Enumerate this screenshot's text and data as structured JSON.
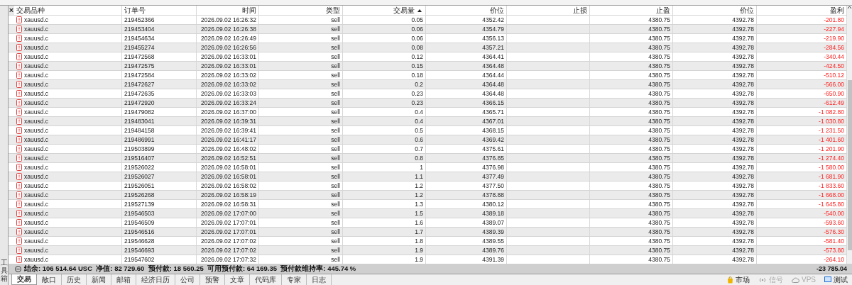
{
  "toolbox_label": "工具箱",
  "columns": [
    {
      "label": "交易品种",
      "sorted": false
    },
    {
      "label": "订单号",
      "sorted": false
    },
    {
      "label": "时间",
      "sorted": false
    },
    {
      "label": "类型",
      "sorted": false
    },
    {
      "label": "交易量",
      "sorted": true
    },
    {
      "label": "价位",
      "sorted": false
    },
    {
      "label": "止损",
      "sorted": false
    },
    {
      "label": "止盈",
      "sorted": false
    },
    {
      "label": "价位",
      "sorted": false
    },
    {
      "label": "盈利",
      "sorted": false
    }
  ],
  "close_glyph": "×",
  "rows": [
    {
      "symbol": "xauusd.c",
      "order": "219452366",
      "time": "2026.09.02 16:26:32",
      "type": "sell",
      "volume": "0.05",
      "price": "4352.42",
      "tp": "4380.75",
      "current": "4392.78",
      "profit": "-201.80"
    },
    {
      "symbol": "xauusd.c",
      "order": "219453404",
      "time": "2026.09.02 16:26:38",
      "type": "sell",
      "volume": "0.06",
      "price": "4354.79",
      "tp": "4380.75",
      "current": "4392.78",
      "profit": "-227.94"
    },
    {
      "symbol": "xauusd.c",
      "order": "219454634",
      "time": "2026.09.02 16:26:49",
      "type": "sell",
      "volume": "0.06",
      "price": "4356.13",
      "tp": "4380.75",
      "current": "4392.78",
      "profit": "-219.90"
    },
    {
      "symbol": "xauusd.c",
      "order": "219455274",
      "time": "2026.09.02 16:26:56",
      "type": "sell",
      "volume": "0.08",
      "price": "4357.21",
      "tp": "4380.75",
      "current": "4392.78",
      "profit": "-284.56"
    },
    {
      "symbol": "xauusd.c",
      "order": "219472568",
      "time": "2026.09.02 16:33:01",
      "type": "sell",
      "volume": "0.12",
      "price": "4364.41",
      "tp": "4380.75",
      "current": "4392.78",
      "profit": "-340.44"
    },
    {
      "symbol": "xauusd.c",
      "order": "219472575",
      "time": "2026.09.02 16:33:01",
      "type": "sell",
      "volume": "0.15",
      "price": "4364.48",
      "tp": "4380.75",
      "current": "4392.78",
      "profit": "-424.50"
    },
    {
      "symbol": "xauusd.c",
      "order": "219472584",
      "time": "2026.09.02 16:33:02",
      "type": "sell",
      "volume": "0.18",
      "price": "4364.44",
      "tp": "4380.75",
      "current": "4392.78",
      "profit": "-510.12"
    },
    {
      "symbol": "xauusd.c",
      "order": "219472627",
      "time": "2026.09.02 16:33:02",
      "type": "sell",
      "volume": "0.2",
      "price": "4364.48",
      "tp": "4380.75",
      "current": "4392.78",
      "profit": "-566.00"
    },
    {
      "symbol": "xauusd.c",
      "order": "219472635",
      "time": "2026.09.02 16:33:03",
      "type": "sell",
      "volume": "0.23",
      "price": "4364.48",
      "tp": "4380.75",
      "current": "4392.78",
      "profit": "-650.90"
    },
    {
      "symbol": "xauusd.c",
      "order": "219472920",
      "time": "2026.09.02 16:33:24",
      "type": "sell",
      "volume": "0.23",
      "price": "4366.15",
      "tp": "4380.75",
      "current": "4392.78",
      "profit": "-612.49"
    },
    {
      "symbol": "xauusd.c",
      "order": "219479082",
      "time": "2026.09.02 16:37:00",
      "type": "sell",
      "volume": "0.4",
      "price": "4365.71",
      "tp": "4380.75",
      "current": "4392.78",
      "profit": "-1 082.80"
    },
    {
      "symbol": "xauusd.c",
      "order": "219483041",
      "time": "2026.09.02 16:39:31",
      "type": "sell",
      "volume": "0.4",
      "price": "4367.01",
      "tp": "4380.75",
      "current": "4392.78",
      "profit": "-1 030.80"
    },
    {
      "symbol": "xauusd.c",
      "order": "219484158",
      "time": "2026.09.02 16:39:41",
      "type": "sell",
      "volume": "0.5",
      "price": "4368.15",
      "tp": "4380.75",
      "current": "4392.78",
      "profit": "-1 231.50"
    },
    {
      "symbol": "xauusd.c",
      "order": "219486991",
      "time": "2026.09.02 16:41:17",
      "type": "sell",
      "volume": "0.6",
      "price": "4369.42",
      "tp": "4380.75",
      "current": "4392.78",
      "profit": "-1 401.60"
    },
    {
      "symbol": "xauusd.c",
      "order": "219503899",
      "time": "2026.09.02 16:48:02",
      "type": "sell",
      "volume": "0.7",
      "price": "4375.61",
      "tp": "4380.75",
      "current": "4392.78",
      "profit": "-1 201.90"
    },
    {
      "symbol": "xauusd.c",
      "order": "219516407",
      "time": "2026.09.02 16:52:51",
      "type": "sell",
      "volume": "0.8",
      "price": "4376.85",
      "tp": "4380.75",
      "current": "4392.78",
      "profit": "-1 274.40"
    },
    {
      "symbol": "xauusd.c",
      "order": "219526022",
      "time": "2026.09.02 16:58:01",
      "type": "sell",
      "volume": "1",
      "price": "4376.98",
      "tp": "4380.75",
      "current": "4392.78",
      "profit": "-1 580.00"
    },
    {
      "symbol": "xauusd.c",
      "order": "219526027",
      "time": "2026.09.02 16:58:01",
      "type": "sell",
      "volume": "1.1",
      "price": "4377.49",
      "tp": "4380.75",
      "current": "4392.78",
      "profit": "-1 681.90"
    },
    {
      "symbol": "xauusd.c",
      "order": "219526051",
      "time": "2026.09.02 16:58:02",
      "type": "sell",
      "volume": "1.2",
      "price": "4377.50",
      "tp": "4380.75",
      "current": "4392.78",
      "profit": "-1 833.60"
    },
    {
      "symbol": "xauusd.c",
      "order": "219526268",
      "time": "2026.09.02 16:58:19",
      "type": "sell",
      "volume": "1.2",
      "price": "4378.88",
      "tp": "4380.75",
      "current": "4392.78",
      "profit": "-1 668.00"
    },
    {
      "symbol": "xauusd.c",
      "order": "219527139",
      "time": "2026.09.02 16:58:31",
      "type": "sell",
      "volume": "1.3",
      "price": "4380.12",
      "tp": "4380.75",
      "current": "4392.78",
      "profit": "-1 645.80"
    },
    {
      "symbol": "xauusd.c",
      "order": "219546503",
      "time": "2026.09.02 17:07:00",
      "type": "sell",
      "volume": "1.5",
      "price": "4389.18",
      "tp": "4380.75",
      "current": "4392.78",
      "profit": "-540.00"
    },
    {
      "symbol": "xauusd.c",
      "order": "219546509",
      "time": "2026.09.02 17:07:01",
      "type": "sell",
      "volume": "1.6",
      "price": "4389.07",
      "tp": "4380.75",
      "current": "4392.78",
      "profit": "-593.60"
    },
    {
      "symbol": "xauusd.c",
      "order": "219546516",
      "time": "2026.09.02 17:07:01",
      "type": "sell",
      "volume": "1.7",
      "price": "4389.39",
      "tp": "4380.75",
      "current": "4392.78",
      "profit": "-576.30"
    },
    {
      "symbol": "xauusd.c",
      "order": "219546628",
      "time": "2026.09.02 17:07:02",
      "type": "sell",
      "volume": "1.8",
      "price": "4389.55",
      "tp": "4380.75",
      "current": "4392.78",
      "profit": "-581.40"
    },
    {
      "symbol": "xauusd.c",
      "order": "219546693",
      "time": "2026.09.02 17:07:02",
      "type": "sell",
      "volume": "1.9",
      "price": "4389.76",
      "tp": "4380.75",
      "current": "4392.78",
      "profit": "-573.80"
    },
    {
      "symbol": "xauusd.c",
      "order": "219547602",
      "time": "2026.09.02 17:07:32",
      "type": "sell",
      "volume": "1.9",
      "price": "4391.39",
      "tp": "4380.75",
      "current": "4392.78",
      "profit": "-264.10"
    }
  ],
  "summary": {
    "text": "结余: 106 514.64 USC  净值: 82 729.60  预付款: 18 560.25  可用预付款: 64 169.35  预付款维持率: 445.74 %",
    "total": "-23 785.04"
  },
  "tabs": [
    {
      "label": "交易",
      "selected": true
    },
    {
      "label": "敞口",
      "selected": false
    },
    {
      "label": "历史",
      "selected": false
    },
    {
      "label": "新闻",
      "selected": false
    },
    {
      "label": "邮箱",
      "selected": false
    },
    {
      "label": "经济日历",
      "selected": false
    },
    {
      "label": "公司",
      "selected": false
    },
    {
      "label": "预警",
      "selected": false
    },
    {
      "label": "文章",
      "selected": false
    },
    {
      "label": "代码库",
      "selected": false
    },
    {
      "label": "专家",
      "selected": false
    },
    {
      "label": "日志",
      "selected": false
    }
  ],
  "services": [
    {
      "kind": "market",
      "label": "市场",
      "disabled": false
    },
    {
      "kind": "signal",
      "label": "信号",
      "disabled": true
    },
    {
      "kind": "vps",
      "label": "VPS",
      "disabled": true
    },
    {
      "kind": "tester",
      "label": "测试",
      "disabled": false
    }
  ]
}
